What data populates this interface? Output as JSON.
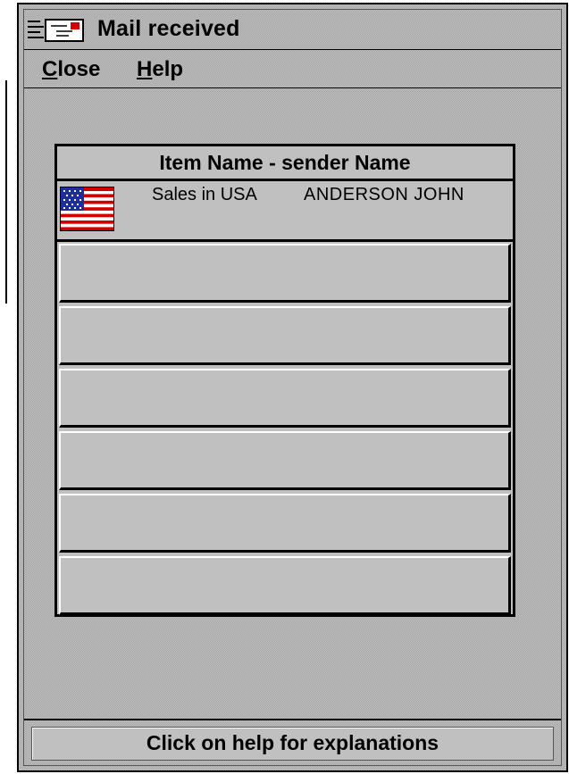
{
  "window": {
    "title": "Mail received",
    "icon": "mail-envelope-icon"
  },
  "menu": {
    "close_label": "Close",
    "close_underline": "C",
    "close_rest": "lose",
    "help_label": "Help",
    "help_underline": "H",
    "help_rest": "elp"
  },
  "list": {
    "header": "Item Name  - sender Name",
    "rows": [
      {
        "icon": "us-flag-icon",
        "item_name": "Sales in USA",
        "sender_name": "ANDERSON  JOHN"
      },
      {
        "item_name": "",
        "sender_name": ""
      },
      {
        "item_name": "",
        "sender_name": ""
      },
      {
        "item_name": "",
        "sender_name": ""
      },
      {
        "item_name": "",
        "sender_name": ""
      },
      {
        "item_name": "",
        "sender_name": ""
      },
      {
        "item_name": "",
        "sender_name": ""
      }
    ]
  },
  "status": {
    "text": "Click on help for explanations"
  },
  "colors": {
    "face": "#c0c0c0",
    "flag_red": "#d20000",
    "flag_blue": "#1e2d9c"
  }
}
